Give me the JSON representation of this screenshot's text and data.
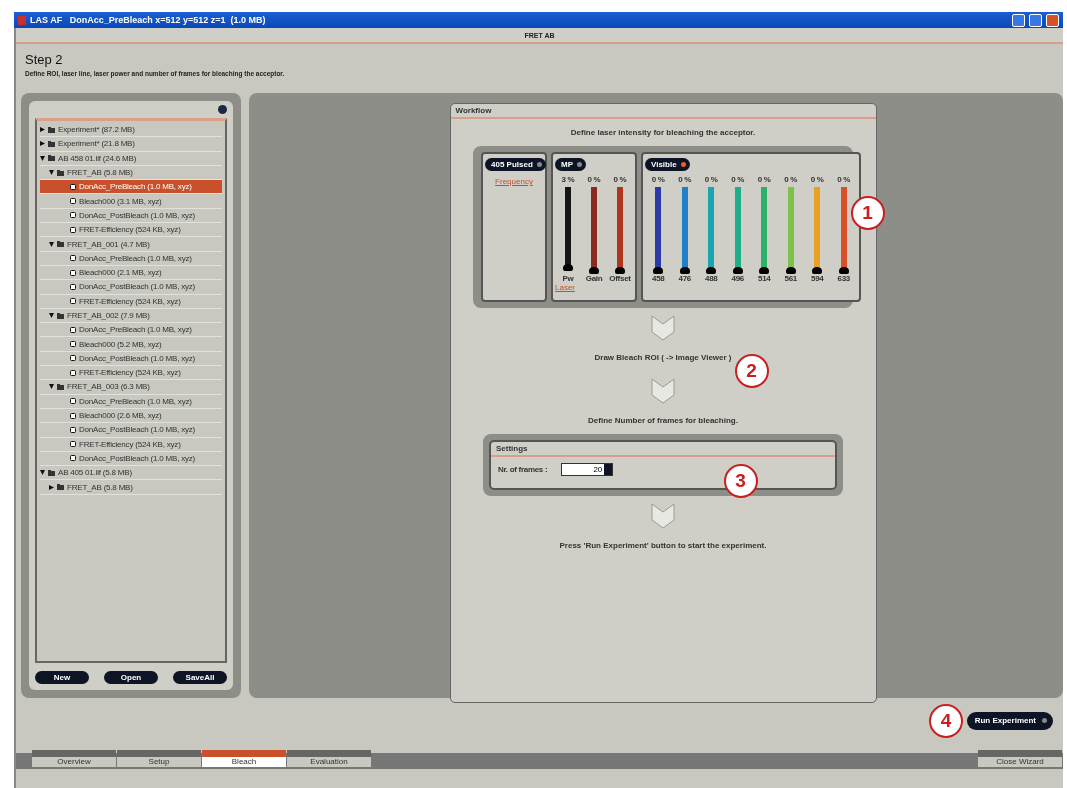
{
  "window": {
    "title": "LAS AF   DonAcc_PreBleach x=512 y=512 z=1  (1.0 MB)"
  },
  "wizard": {
    "title": "FRET AB",
    "step": "Step 2",
    "description": "Define ROI, laser line, laser power and number of frames for bleaching the acceptor."
  },
  "tree": [
    {
      "kind": "folder",
      "label": "Experiment* (87.2 MB)",
      "expanded": false,
      "selected": false
    },
    {
      "kind": "folder",
      "label": "Experiment* (21.8 MB)",
      "expanded": false,
      "selected": false
    },
    {
      "kind": "folder",
      "label": "AB 458 01.lif (24.6 MB)",
      "expanded": true,
      "selected": false,
      "children": [
        {
          "kind": "folder",
          "label": "FRET_AB (5.8 MB)",
          "expanded": true,
          "selected": false,
          "children": [
            {
              "kind": "file",
              "label": "DonAcc_PreBleach (1.0 MB, xyz)",
              "selected": true
            },
            {
              "kind": "file",
              "label": "Bleach000 (3.1 MB, xyz)",
              "selected": false
            },
            {
              "kind": "file",
              "label": "DonAcc_PostBleach (1.0 MB, xyz)",
              "selected": false
            },
            {
              "kind": "file",
              "label": "FRET-Efficiency (524 KB, xyz)",
              "selected": false
            }
          ]
        },
        {
          "kind": "folder",
          "label": "FRET_AB_001 (4.7 MB)",
          "expanded": true,
          "selected": false,
          "children": [
            {
              "kind": "file",
              "label": "DonAcc_PreBleach (1.0 MB, xyz)",
              "selected": false
            },
            {
              "kind": "file",
              "label": "Bleach000 (2.1 MB, xyz)",
              "selected": false
            },
            {
              "kind": "file",
              "label": "DonAcc_PostBleach (1.0 MB, xyz)",
              "selected": false
            },
            {
              "kind": "file",
              "label": "FRET-Efficiency (524 KB, xyz)",
              "selected": false
            }
          ]
        },
        {
          "kind": "folder",
          "label": "FRET_AB_002 (7.9 MB)",
          "expanded": true,
          "selected": false,
          "children": [
            {
              "kind": "file",
              "label": "DonAcc_PreBleach (1.0 MB, xyz)",
              "selected": false
            },
            {
              "kind": "file",
              "label": "Bleach000 (5.2 MB, xyz)",
              "selected": false
            },
            {
              "kind": "file",
              "label": "DonAcc_PostBleach (1.0 MB, xyz)",
              "selected": false
            },
            {
              "kind": "file",
              "label": "FRET-Efficiency (524 KB, xyz)",
              "selected": false
            }
          ]
        },
        {
          "kind": "folder",
          "label": "FRET_AB_003 (6.3 MB)",
          "expanded": true,
          "selected": false,
          "children": [
            {
              "kind": "file",
              "label": "DonAcc_PreBleach (1.0 MB, xyz)",
              "selected": false
            },
            {
              "kind": "file",
              "label": "Bleach000 (2.6 MB, xyz)",
              "selected": false
            },
            {
              "kind": "file",
              "label": "DonAcc_PostBleach (1.0 MB, xyz)",
              "selected": false
            },
            {
              "kind": "file",
              "label": "FRET-Efficiency (524 KB, xyz)",
              "selected": false
            },
            {
              "kind": "file",
              "label": "DonAcc_PostBleach (1.0 MB, xyz)",
              "selected": false
            }
          ]
        }
      ]
    },
    {
      "kind": "folder",
      "label": "AB 405 01.lif (5.8 MB)",
      "expanded": true,
      "selected": false,
      "children": [
        {
          "kind": "folder",
          "label": "FRET_AB (5.8 MB)",
          "expanded": false,
          "selected": false
        }
      ]
    }
  ],
  "tree_buttons": [
    "New",
    "Open",
    "SaveAll"
  ],
  "workflow": {
    "title": "Workflow",
    "steps": [
      "Define laser intensity for bleaching the acceptor.",
      "Draw Bleach ROI ( -> Image Viewer )",
      "Define Number of frames for bleaching.",
      "Press 'Run Experiment' button to start the experiment."
    ]
  },
  "laser_groups": [
    {
      "label": "405 Pulsed",
      "on": false,
      "link": "Frequency"
    },
    {
      "label": "MP",
      "on": false,
      "link": "Laser",
      "channels": [
        {
          "reading": "3 %",
          "name": "Pw",
          "level": 0.03,
          "color": "#151515"
        },
        {
          "reading": "0 %",
          "name": "Gain",
          "level": 0,
          "color": "#8a2a20"
        },
        {
          "reading": "0 %",
          "name": "Offset",
          "level": 0,
          "color": "#b0361e"
        }
      ]
    },
    {
      "label": "Visible",
      "on": true,
      "channels": [
        {
          "reading": "0 %",
          "name": "458",
          "level": 0,
          "color": "#2a3aa8"
        },
        {
          "reading": "0 %",
          "name": "476",
          "level": 0,
          "color": "#1f7fc8"
        },
        {
          "reading": "0 %",
          "name": "488",
          "level": 0,
          "color": "#1aa6b0"
        },
        {
          "reading": "0 %",
          "name": "496",
          "level": 0,
          "color": "#1fae8a"
        },
        {
          "reading": "0 %",
          "name": "514",
          "level": 0,
          "color": "#2fb06a"
        },
        {
          "reading": "0 %",
          "name": "561",
          "level": 0,
          "color": "#7cc24a"
        },
        {
          "reading": "0 %",
          "name": "594",
          "level": 0,
          "color": "#e8a020"
        },
        {
          "reading": "0 %",
          "name": "633",
          "level": 0,
          "color": "#d8502a"
        }
      ]
    }
  ],
  "settings": {
    "title": "Settings",
    "label": "Nr. of frames :",
    "value": "20"
  },
  "run_button": "Run Experiment",
  "callouts": [
    "1",
    "2",
    "3",
    "4"
  ],
  "bottom_tabs": [
    {
      "label": "Overview",
      "selected": false
    },
    {
      "label": "Setup",
      "selected": false
    },
    {
      "label": "Bleach",
      "selected": true
    },
    {
      "label": "Evaluation",
      "selected": false
    }
  ],
  "close_button": "Close Wizard"
}
